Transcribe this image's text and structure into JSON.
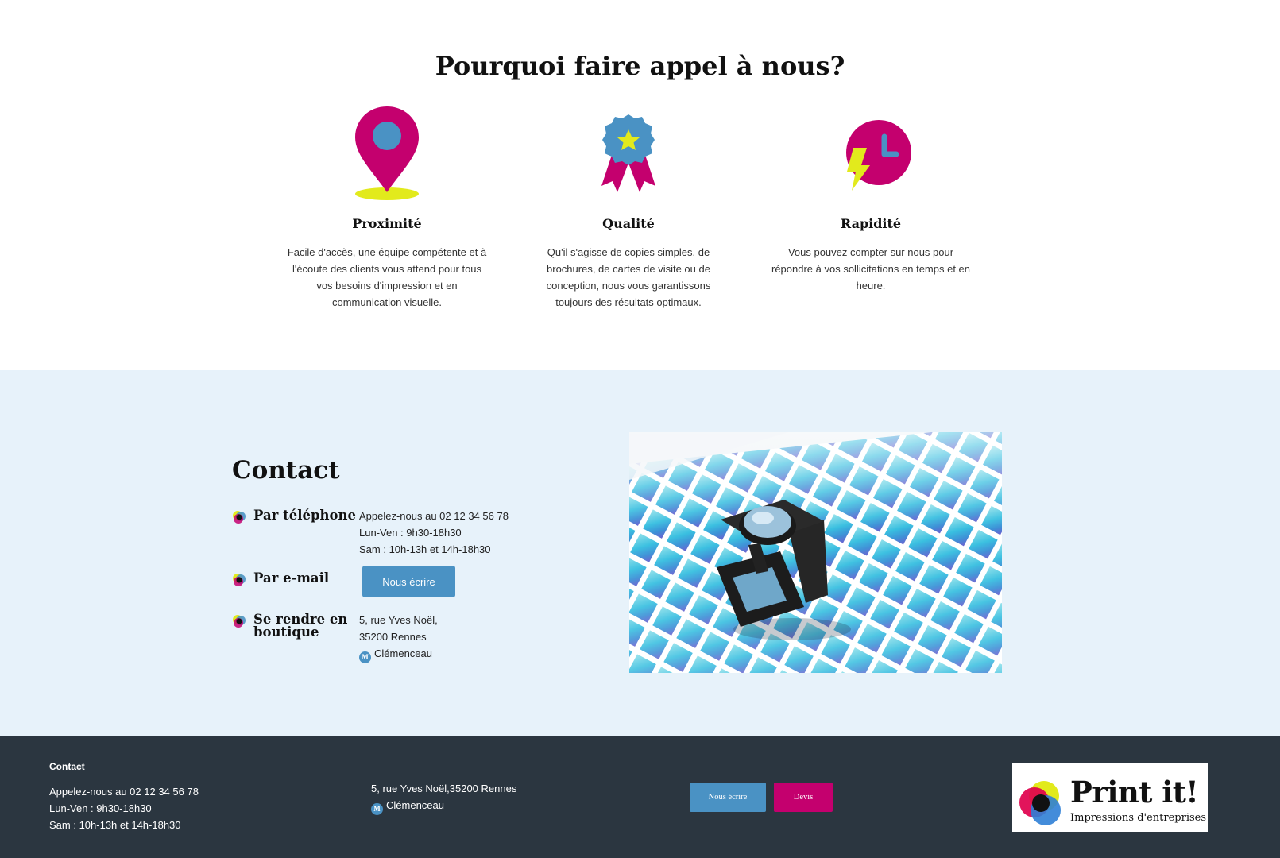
{
  "why": {
    "title": "Pourquoi faire appel à nous?",
    "features": [
      {
        "icon": "map-pin-icon",
        "title": "Proximité",
        "text": "Facile d'accès, une équipe compétente et à l'écoute des clients vous attend pour tous vos besoins d'impression et en communication visuelle."
      },
      {
        "icon": "award-ribbon-icon",
        "title": "Qualité",
        "text": "Qu'il s'agisse de copies simples, de brochures, de cartes de visite ou de conception, nous vous garantissons toujours des résultats optimaux."
      },
      {
        "icon": "lightning-clock-icon",
        "title": "Rapidité",
        "text": "Vous pouvez compter sur nous pour répondre à vos sollicitations en temps et en heure."
      }
    ]
  },
  "contact": {
    "title": "Contact",
    "phone": {
      "label": "Par téléphone",
      "line1": "Appelez-nous au 02 12 34 56 78",
      "line2": "Lun-Ven : 9h30-18h30",
      "line3": "Sam : 10h-13h et 14h-18h30"
    },
    "email": {
      "label": "Par e-mail",
      "button": "Nous écrire"
    },
    "shop": {
      "label": "Se rendre en boutique",
      "address1": "5, rue Yves Noël,",
      "address2": "35200 Rennes",
      "metro_badge": "M",
      "metro": "Clémenceau"
    }
  },
  "footer": {
    "heading": "Contact",
    "line1": "Appelez-nous au 02 12 34 56 78",
    "line2": "Lun-Ven : 9h30-18h30",
    "line3": "Sam : 10h-13h et 14h-18h30",
    "address": "5, rue Yves Noël,35200 Rennes",
    "metro_badge": "M",
    "metro": "Clémenceau",
    "btn_write": "Nous écrire",
    "btn_quote": "Devis",
    "logo_brand": "Print it!",
    "logo_tagline": "Impressions d'entreprises"
  },
  "colors": {
    "magenta": "#c4006e",
    "blue": "#4a92c4",
    "yellow": "#e2ea1c",
    "light_bg": "#e7f2fa",
    "footer_bg": "#2b3640"
  }
}
